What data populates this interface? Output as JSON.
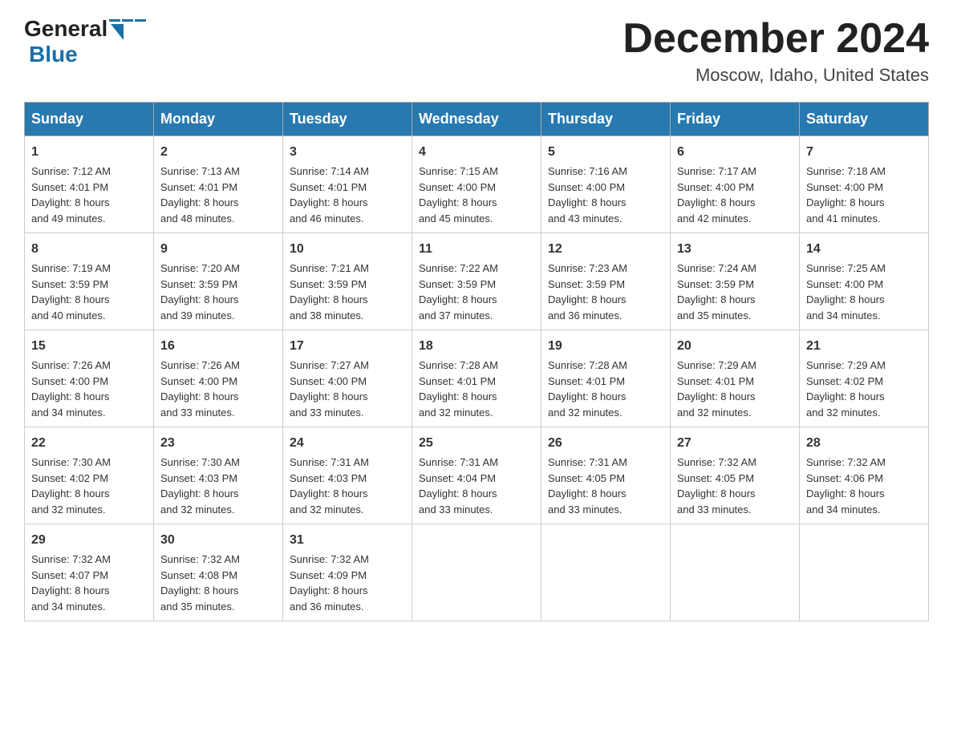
{
  "header": {
    "logo_general": "General",
    "logo_blue": "Blue",
    "title": "December 2024",
    "subtitle": "Moscow, Idaho, United States"
  },
  "days_of_week": [
    "Sunday",
    "Monday",
    "Tuesday",
    "Wednesday",
    "Thursday",
    "Friday",
    "Saturday"
  ],
  "weeks": [
    [
      {
        "day": "1",
        "sunrise": "7:12 AM",
        "sunset": "4:01 PM",
        "daylight": "8 hours and 49 minutes."
      },
      {
        "day": "2",
        "sunrise": "7:13 AM",
        "sunset": "4:01 PM",
        "daylight": "8 hours and 48 minutes."
      },
      {
        "day": "3",
        "sunrise": "7:14 AM",
        "sunset": "4:01 PM",
        "daylight": "8 hours and 46 minutes."
      },
      {
        "day": "4",
        "sunrise": "7:15 AM",
        "sunset": "4:00 PM",
        "daylight": "8 hours and 45 minutes."
      },
      {
        "day": "5",
        "sunrise": "7:16 AM",
        "sunset": "4:00 PM",
        "daylight": "8 hours and 43 minutes."
      },
      {
        "day": "6",
        "sunrise": "7:17 AM",
        "sunset": "4:00 PM",
        "daylight": "8 hours and 42 minutes."
      },
      {
        "day": "7",
        "sunrise": "7:18 AM",
        "sunset": "4:00 PM",
        "daylight": "8 hours and 41 minutes."
      }
    ],
    [
      {
        "day": "8",
        "sunrise": "7:19 AM",
        "sunset": "3:59 PM",
        "daylight": "8 hours and 40 minutes."
      },
      {
        "day": "9",
        "sunrise": "7:20 AM",
        "sunset": "3:59 PM",
        "daylight": "8 hours and 39 minutes."
      },
      {
        "day": "10",
        "sunrise": "7:21 AM",
        "sunset": "3:59 PM",
        "daylight": "8 hours and 38 minutes."
      },
      {
        "day": "11",
        "sunrise": "7:22 AM",
        "sunset": "3:59 PM",
        "daylight": "8 hours and 37 minutes."
      },
      {
        "day": "12",
        "sunrise": "7:23 AM",
        "sunset": "3:59 PM",
        "daylight": "8 hours and 36 minutes."
      },
      {
        "day": "13",
        "sunrise": "7:24 AM",
        "sunset": "3:59 PM",
        "daylight": "8 hours and 35 minutes."
      },
      {
        "day": "14",
        "sunrise": "7:25 AM",
        "sunset": "4:00 PM",
        "daylight": "8 hours and 34 minutes."
      }
    ],
    [
      {
        "day": "15",
        "sunrise": "7:26 AM",
        "sunset": "4:00 PM",
        "daylight": "8 hours and 34 minutes."
      },
      {
        "day": "16",
        "sunrise": "7:26 AM",
        "sunset": "4:00 PM",
        "daylight": "8 hours and 33 minutes."
      },
      {
        "day": "17",
        "sunrise": "7:27 AM",
        "sunset": "4:00 PM",
        "daylight": "8 hours and 33 minutes."
      },
      {
        "day": "18",
        "sunrise": "7:28 AM",
        "sunset": "4:01 PM",
        "daylight": "8 hours and 32 minutes."
      },
      {
        "day": "19",
        "sunrise": "7:28 AM",
        "sunset": "4:01 PM",
        "daylight": "8 hours and 32 minutes."
      },
      {
        "day": "20",
        "sunrise": "7:29 AM",
        "sunset": "4:01 PM",
        "daylight": "8 hours and 32 minutes."
      },
      {
        "day": "21",
        "sunrise": "7:29 AM",
        "sunset": "4:02 PM",
        "daylight": "8 hours and 32 minutes."
      }
    ],
    [
      {
        "day": "22",
        "sunrise": "7:30 AM",
        "sunset": "4:02 PM",
        "daylight": "8 hours and 32 minutes."
      },
      {
        "day": "23",
        "sunrise": "7:30 AM",
        "sunset": "4:03 PM",
        "daylight": "8 hours and 32 minutes."
      },
      {
        "day": "24",
        "sunrise": "7:31 AM",
        "sunset": "4:03 PM",
        "daylight": "8 hours and 32 minutes."
      },
      {
        "day": "25",
        "sunrise": "7:31 AM",
        "sunset": "4:04 PM",
        "daylight": "8 hours and 33 minutes."
      },
      {
        "day": "26",
        "sunrise": "7:31 AM",
        "sunset": "4:05 PM",
        "daylight": "8 hours and 33 minutes."
      },
      {
        "day": "27",
        "sunrise": "7:32 AM",
        "sunset": "4:05 PM",
        "daylight": "8 hours and 33 minutes."
      },
      {
        "day": "28",
        "sunrise": "7:32 AM",
        "sunset": "4:06 PM",
        "daylight": "8 hours and 34 minutes."
      }
    ],
    [
      {
        "day": "29",
        "sunrise": "7:32 AM",
        "sunset": "4:07 PM",
        "daylight": "8 hours and 34 minutes."
      },
      {
        "day": "30",
        "sunrise": "7:32 AM",
        "sunset": "4:08 PM",
        "daylight": "8 hours and 35 minutes."
      },
      {
        "day": "31",
        "sunrise": "7:32 AM",
        "sunset": "4:09 PM",
        "daylight": "8 hours and 36 minutes."
      },
      null,
      null,
      null,
      null
    ]
  ]
}
